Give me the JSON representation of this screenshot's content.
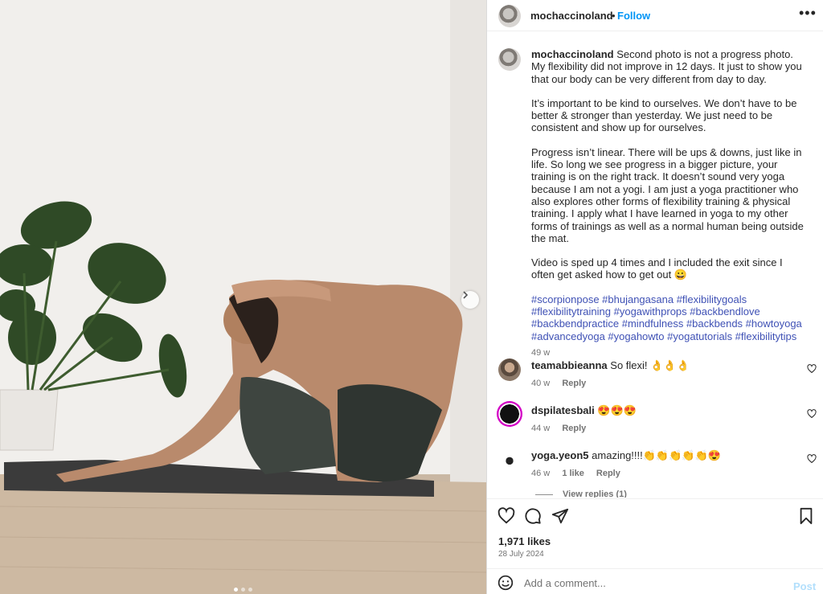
{
  "post": {
    "username": "mochaccinoland",
    "separator": "•",
    "follow_label": "Follow",
    "more_label": "•••"
  },
  "caption": {
    "username": "mochaccinoland",
    "p1": "Second photo is not a progress photo. My flexibility did not improve in 12 days. It just to show you that our body can be very different from day to day.",
    "p2": "It’s important to be kind to ourselves. We don’t have to be better & stronger than yesterday. We just need to be consistent and show up for ourselves.",
    "p3": "Progress isn’t linear. There will be ups & downs, just like in life. So long we see progress in a bigger picture, your training is on the right track. It doesn’t sound very yoga because I am not a yogi. I am just a yoga practitioner who also explores other forms of flexibility training & physical training. I apply what I have learned in yoga to my other forms of trainings as well as a normal human being outside the mat.",
    "p4": "Video is sped up 4 times and I included the exit since I often get asked how to get out 😀",
    "hashtags": "#scorpionpose #bhujangasana #flexibilitygoals #flexibilitytraining #yogawithprops #backbendlove #backbendpractice #mindfulness #backbends #howtoyoga #advancedyoga #yogahowto #yogatutorials #flexibilitytips",
    "time": "49 w"
  },
  "comments": [
    {
      "username": "teamabbieanna",
      "text": "So flexi! 👌👌👌",
      "time": "40 w",
      "likes": "",
      "reply_label": "Reply"
    },
    {
      "username": "dspilatesbali",
      "text": "😍😍😍",
      "time": "44 w",
      "likes": "",
      "reply_label": "Reply"
    },
    {
      "username": "yoga.yeon5",
      "text": "amazing!!!!👏👏👏👏👏😍",
      "time": "46 w",
      "likes": "1 like",
      "reply_label": "Reply"
    }
  ],
  "view_replies": "View replies (1)",
  "likes": "1,971 likes",
  "date": "28 July 2024",
  "add_comment": {
    "placeholder": "Add a comment...",
    "post_label": "Post"
  },
  "carousel": {
    "slides": 3,
    "active": 0
  },
  "colors": {
    "link": "#0095f6",
    "hashtag": "#3f51b5",
    "muted": "#737373",
    "post_disabled": "#b2dffc"
  }
}
